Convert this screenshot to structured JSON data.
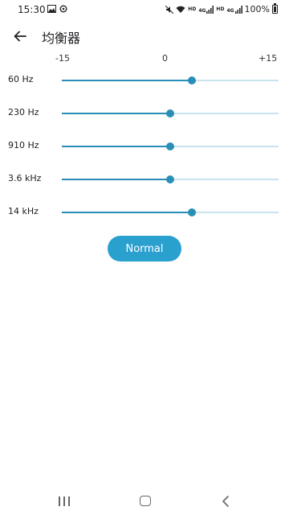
{
  "status_bar": {
    "time": "15:30",
    "battery": "100%",
    "icons": [
      "image-icon",
      "sync-icon",
      "mute-icon",
      "wifi-icon",
      "hd-signal-icon",
      "hd-signal-icon",
      "battery-icon"
    ],
    "hd_label": "HD",
    "network_label": "4G"
  },
  "app_bar": {
    "title": "均衡器",
    "back_icon": "arrow-left-icon"
  },
  "scale": {
    "min": "-15",
    "mid": "0",
    "max": "+15"
  },
  "bands": [
    {
      "label": "60 Hz",
      "level": 0.6
    },
    {
      "label": "230 Hz",
      "level": 0.5
    },
    {
      "label": "910 Hz",
      "level": 0.5
    },
    {
      "label": "3.6 kHz",
      "level": 0.5
    },
    {
      "label": "14 kHz",
      "level": 0.6
    }
  ],
  "preset_button": {
    "label": "Normal"
  },
  "colors": {
    "accent": "#2a8fb8",
    "button": "#2aa0cf",
    "track": "#c9e3ee"
  },
  "nav_bar": {
    "icons": [
      "recent-apps-icon",
      "home-icon",
      "back-icon"
    ]
  }
}
